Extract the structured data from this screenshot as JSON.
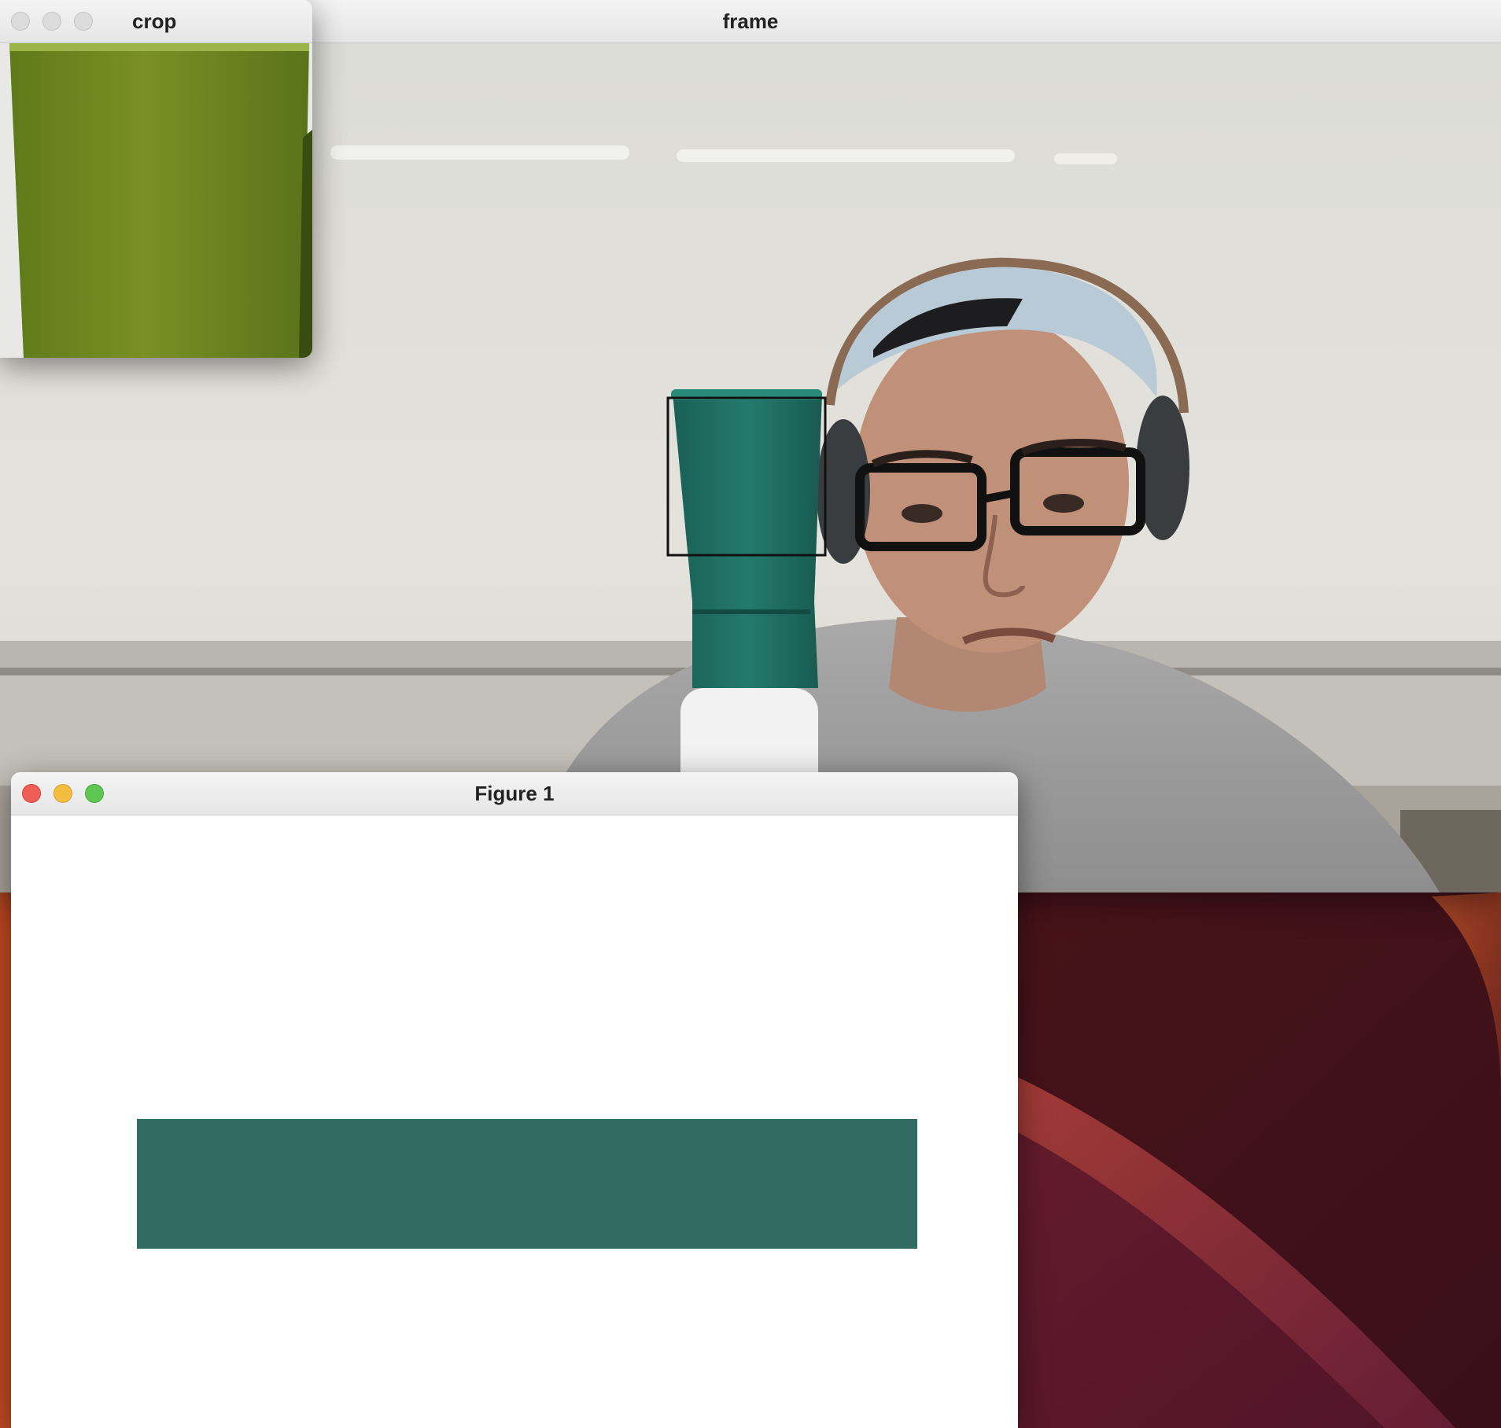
{
  "windows": {
    "frame": {
      "title": "frame"
    },
    "crop": {
      "title": "crop"
    },
    "figure": {
      "title": "Figure 1"
    }
  },
  "colors": {
    "detected_swatch": "#326b62",
    "crop_tint": "#6e8a1e",
    "bottle": "#1f6e63",
    "desktop": "#5a1a1c"
  },
  "icons": [
    "close-icon",
    "minimize-icon",
    "zoom-icon"
  ]
}
